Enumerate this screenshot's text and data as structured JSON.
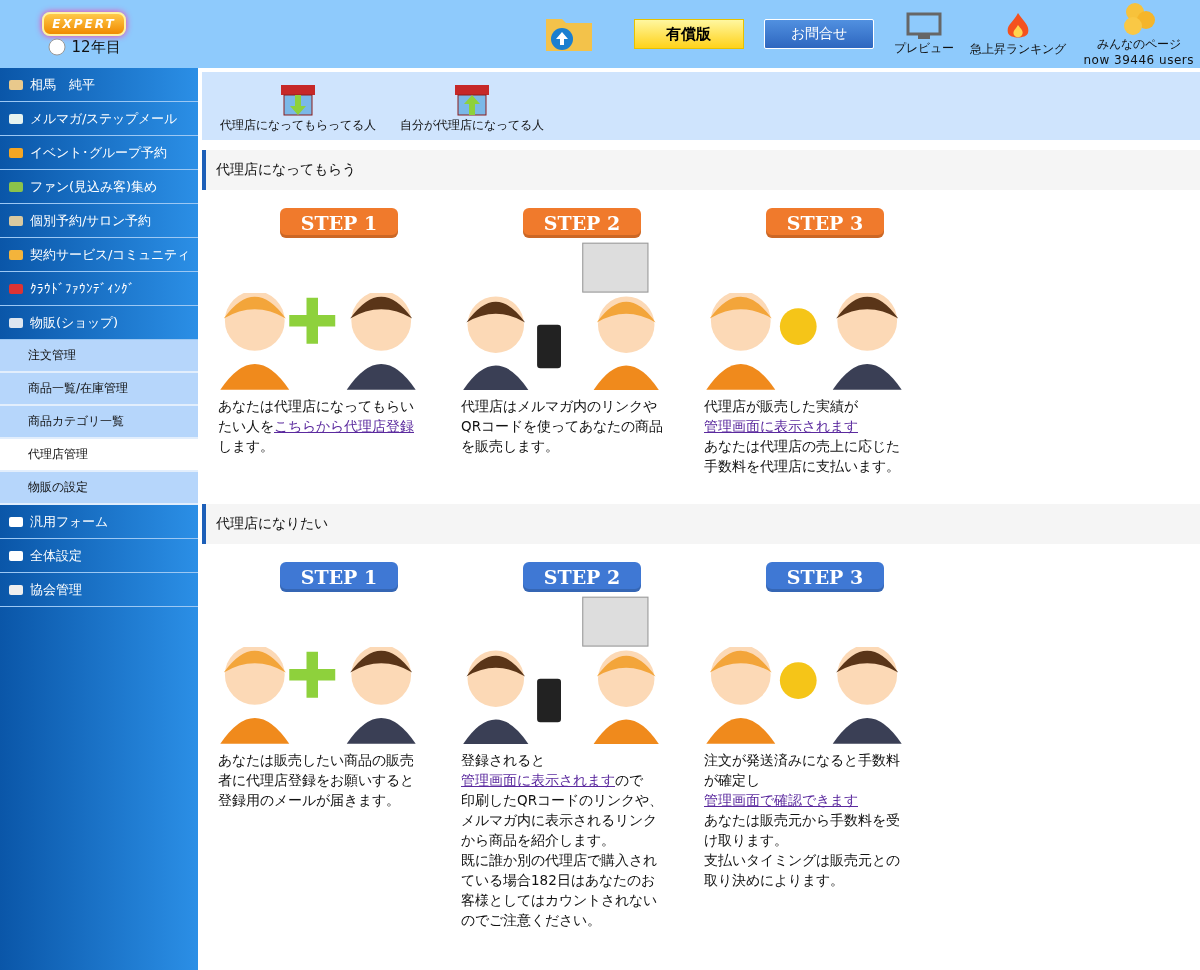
{
  "header": {
    "logo_text": "EXPERT",
    "years": "12年目",
    "paid_button": "有償版",
    "contact_button": "お問合せ",
    "preview": "プレビュー",
    "ranking": "急上昇ランキング",
    "everyone_page": "みんなのページ",
    "users": "now 39446 users"
  },
  "sidebar": {
    "items": [
      {
        "kind": "main",
        "label": "相馬　純平",
        "selected": false
      },
      {
        "kind": "main",
        "label": "メルマガ/ステップメール",
        "selected": false
      },
      {
        "kind": "main",
        "label": "イベント･グループ予約",
        "selected": false
      },
      {
        "kind": "main",
        "label": "ファン(見込み客)集め",
        "selected": false
      },
      {
        "kind": "main",
        "label": "個別予約/サロン予約",
        "selected": false
      },
      {
        "kind": "main",
        "label": "契約サービス/コミュニティ",
        "selected": false
      },
      {
        "kind": "main",
        "label": "ｸﾗｳﾄﾞﾌｧｳﾝﾃﾞｨﾝｸﾞ",
        "selected": false
      },
      {
        "kind": "main",
        "label": "物販(ショップ)",
        "selected": false
      },
      {
        "kind": "sub",
        "label": "注文管理",
        "selected": false
      },
      {
        "kind": "sub",
        "label": "商品一覧/在庫管理",
        "selected": false
      },
      {
        "kind": "sub",
        "label": "商品カテゴリ一覧",
        "selected": false
      },
      {
        "kind": "sub",
        "label": "代理店管理",
        "selected": true
      },
      {
        "kind": "sub",
        "label": "物販の設定",
        "selected": false
      },
      {
        "kind": "main",
        "label": "汎用フォーム",
        "selected": false
      },
      {
        "kind": "main",
        "label": "全体設定",
        "selected": false
      },
      {
        "kind": "main",
        "label": "協会管理",
        "selected": false
      }
    ]
  },
  "toolbar": [
    {
      "kind": "down",
      "label": "代理店になってもらってる人"
    },
    {
      "kind": "up",
      "label": "自分が代理店になってる人"
    }
  ],
  "sections": [
    {
      "title": "代理店になってもらう",
      "color": "#f07a2c",
      "steps": [
        {
          "badge": "STEP 1",
          "kind": "add",
          "paragraphs": [
            [
              {
                "text": "あなたは代理店になってもらいたい人を",
                "link": false
              },
              {
                "text": "こちらから代理店登録",
                "link": true
              },
              {
                "text": "します。",
                "link": false
              }
            ]
          ]
        },
        {
          "badge": "STEP 2",
          "kind": "sell",
          "paragraphs": [
            [
              {
                "text": "代理店はメルマガ内のリンクやQRコードを使ってあなたの商品を販売します。",
                "link": false
              }
            ]
          ]
        },
        {
          "badge": "STEP 3",
          "kind": "pay",
          "paragraphs": [
            [
              {
                "text": "代理店が販売した実績が",
                "link": false
              },
              {
                "text": "管理画面に表示されます",
                "link": true
              }
            ],
            [
              {
                "text": "あなたは代理店の売上に応じた手数料を代理店に支払います。",
                "link": false
              }
            ]
          ]
        }
      ]
    },
    {
      "title": "代理店になりたい",
      "color": "#3f78d4",
      "steps": [
        {
          "badge": "STEP 1",
          "kind": "add",
          "paragraphs": [
            [
              {
                "text": "あなたは販売したい商品の販売者に代理店登録をお願いすると登録用のメールが届きます。",
                "link": false
              }
            ]
          ]
        },
        {
          "badge": "STEP 2",
          "kind": "sell",
          "paragraphs": [
            [
              {
                "text": "登録されると",
                "link": false
              },
              {
                "text": "管理画面に表示されます",
                "link": true
              },
              {
                "text": "ので",
                "link": false
              }
            ],
            [
              {
                "text": "印刷したQRコードのリンクや、メルマガ内に表示されるリンクから商品を紹介します。",
                "link": false
              }
            ],
            [
              {
                "text": "既に誰か別の代理店で購入されている場合182日はあなたのお客様としてはカウントされないのでご注意ください。",
                "link": false
              }
            ]
          ]
        },
        {
          "badge": "STEP 3",
          "kind": "pay",
          "paragraphs": [
            [
              {
                "text": "注文が発送済みになると手数料が確定し",
                "link": false
              },
              {
                "text": "管理画面で確認できます",
                "link": true
              }
            ],
            [
              {
                "text": "あなたは販売元から手数料を受け取ります。",
                "link": false
              }
            ],
            [
              {
                "text": "支払いタイミングは販売元との取り決めによります。",
                "link": false
              }
            ]
          ]
        }
      ]
    }
  ]
}
